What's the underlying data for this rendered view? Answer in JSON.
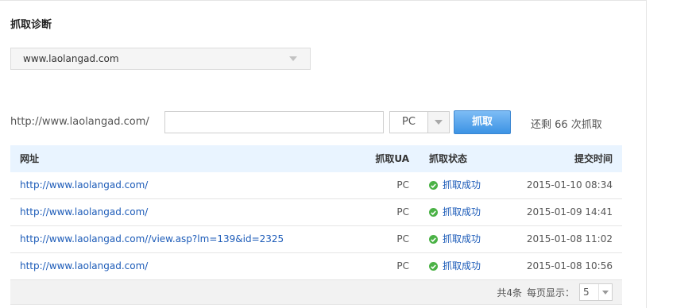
{
  "section_title": "抓取诊断",
  "site_select": {
    "value": "www.laolangad.com"
  },
  "fetch_form": {
    "url_prefix": "http://www.laolangad.com/",
    "url_value": "",
    "ua_value": "PC",
    "fetch_button": "抓取",
    "remaining_text": "还剩 66 次抓取"
  },
  "table": {
    "headers": {
      "url": "网址",
      "ua": "抓取UA",
      "status": "抓取状态",
      "time": "提交时间"
    },
    "rows": [
      {
        "url": "http://www.laolangad.com/",
        "ua": "PC",
        "status": "抓取成功",
        "time": "2015-01-10 08:34"
      },
      {
        "url": "http://www.laolangad.com/",
        "ua": "PC",
        "status": "抓取成功",
        "time": "2015-01-09 14:41"
      },
      {
        "url": "http://www.laolangad.com//view.asp?lm=139&id=2325",
        "ua": "PC",
        "status": "抓取成功",
        "time": "2015-01-08 11:02"
      },
      {
        "url": "http://www.laolangad.com/",
        "ua": "PC",
        "status": "抓取成功",
        "time": "2015-01-08 10:56"
      }
    ],
    "footer": {
      "total_text": "共4条",
      "per_page_label": "每页显示：",
      "per_page_value": "5"
    }
  },
  "colors": {
    "accent": "#3c93e4",
    "link": "#1c5bb8",
    "success": "#4bb246",
    "header_bg": "#e9f4ff"
  },
  "icons": {
    "status": "check-circle-icon",
    "dropdown": "triangle-down-icon"
  }
}
